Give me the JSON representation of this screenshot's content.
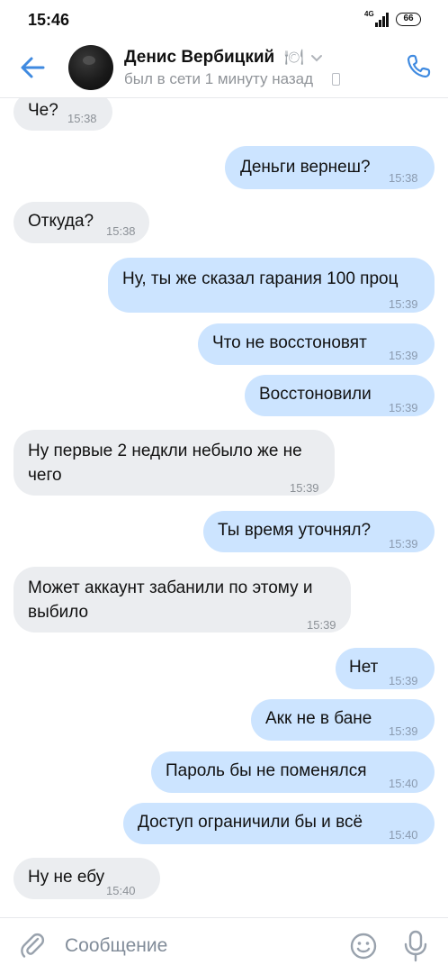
{
  "status_bar": {
    "time": "15:46",
    "network": "4G",
    "battery": "66"
  },
  "header": {
    "name": "Денис Вербицкий",
    "status": "был в сети 1 минуту назад"
  },
  "messages": [
    {
      "dir": "in",
      "text": "Че?",
      "time": "15:38"
    },
    {
      "dir": "out",
      "text": "Деньги вернеш?",
      "time": "15:38"
    },
    {
      "dir": "in",
      "text": "Откуда?",
      "time": "15:38"
    },
    {
      "dir": "out",
      "text": "Ну, ты же сказал гарания 100 проц",
      "time": "15:39"
    },
    {
      "dir": "out",
      "text": "Что не восстоновят",
      "time": "15:39"
    },
    {
      "dir": "out",
      "text": "Восстоновили",
      "time": "15:39"
    },
    {
      "dir": "in",
      "line1": "Ну первые 2 недкли небыло же не",
      "line2": "чего",
      "time": "15:39"
    },
    {
      "dir": "out",
      "text": "Ты время уточнял?",
      "time": "15:39"
    },
    {
      "dir": "in",
      "line1": "Может аккаунт забанили по этому и",
      "line2": "выбило",
      "time": "15:39"
    },
    {
      "dir": "out",
      "text": "Нет",
      "time": "15:39"
    },
    {
      "dir": "out",
      "text": "Акк не в бане",
      "time": "15:39"
    },
    {
      "dir": "out",
      "text": "Пароль бы не поменялся",
      "time": "15:40"
    },
    {
      "dir": "out",
      "text": "Доступ ограничили бы и всё",
      "time": "15:40"
    },
    {
      "dir": "in",
      "text": "Ну не ебу",
      "time": "15:40"
    }
  ],
  "composer": {
    "placeholder": "Сообщение"
  },
  "colors": {
    "accent": "#3f8ae0",
    "incoming": "#ebedf0",
    "outgoing": "#cce4ff"
  }
}
